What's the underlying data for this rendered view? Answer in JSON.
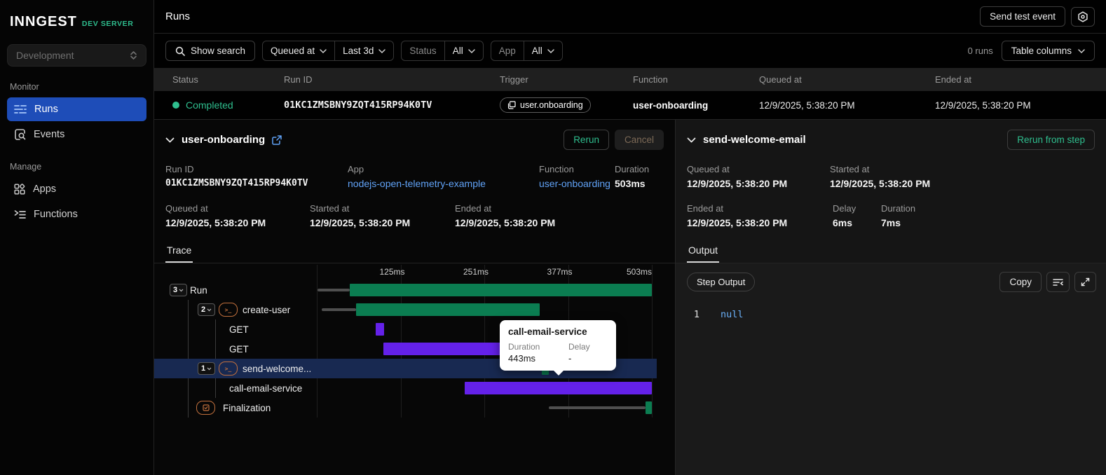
{
  "colors": {
    "green": "#0b7d51",
    "purple": "#6421e9",
    "accent_green": "#2fbf8f",
    "link_blue": "#61a3f8",
    "selected_row": "#182951",
    "sidebar_active": "#1e4db8",
    "step_icon_orange": "#c2703d"
  },
  "sidebar": {
    "logo": "INNGEST",
    "badge": "DEV SERVER",
    "env_select": {
      "value": "Development"
    },
    "sections": [
      {
        "label": "Monitor",
        "items": [
          {
            "label": "Runs",
            "icon": "runs-icon",
            "active": true
          },
          {
            "label": "Events",
            "icon": "events-icon",
            "active": false
          }
        ]
      },
      {
        "label": "Manage",
        "items": [
          {
            "label": "Apps",
            "icon": "apps-icon",
            "active": false
          },
          {
            "label": "Functions",
            "icon": "functions-icon",
            "active": false
          }
        ]
      }
    ]
  },
  "header": {
    "title": "Runs",
    "send_test_event": "Send test event"
  },
  "filters": {
    "show_search": "Show search",
    "queued_at": "Queued at",
    "time_range": "Last 3d",
    "status_label": "Status",
    "status_value": "All",
    "app_label": "App",
    "app_value": "All",
    "runs_count": "0 runs",
    "table_columns": "Table columns"
  },
  "table": {
    "columns": [
      "Status",
      "Run ID",
      "Trigger",
      "Function",
      "Queued at",
      "Ended at"
    ],
    "row": {
      "status": "Completed",
      "run_id": "01KC1ZMSBNY9ZQT415RP94K0TV",
      "trigger": "user.onboarding",
      "function": "user-onboarding",
      "queued_at": "12/9/2025, 5:38:20 PM",
      "ended_at": "12/9/2025, 5:38:20 PM"
    }
  },
  "run_panel": {
    "title": "user-onboarding",
    "rerun": "Rerun",
    "cancel": "Cancel",
    "row1": [
      {
        "label": "Run ID",
        "value": "01KC1ZMSBNY9ZQT415RP94K0TV"
      },
      {
        "label": "App",
        "value": "nodejs-open-telemetry-example"
      },
      {
        "label": "Function",
        "value": "user-onboarding"
      },
      {
        "label": "Duration",
        "value": "503ms"
      }
    ],
    "row2": [
      {
        "label": "Queued at",
        "value": "12/9/2025, 5:38:20 PM"
      },
      {
        "label": "Started at",
        "value": "12/9/2025, 5:38:20 PM"
      },
      {
        "label": "Ended at",
        "value": "12/9/2025, 5:38:20 PM"
      }
    ],
    "tab": "Trace"
  },
  "trace": {
    "axis_max_ms": 503,
    "axis_labels": [
      {
        "text": "125ms",
        "pct": 25
      },
      {
        "text": "251ms",
        "pct": 50
      },
      {
        "text": "377ms",
        "pct": 75
      },
      {
        "text": "503ms",
        "pct": 100
      }
    ],
    "rows": [
      {
        "label": "Run",
        "badge": "3",
        "selected": false,
        "spans": [
          {
            "kind": "queue",
            "start": 1,
            "end": 49
          },
          {
            "kind": "bar",
            "start": 49,
            "end": 503,
            "color": "green"
          }
        ]
      },
      {
        "label": "create-user",
        "badge": "2",
        "icon": "terminal-step-icon",
        "selected": false,
        "spans": [
          {
            "kind": "queue",
            "start": 7,
            "end": 59
          },
          {
            "kind": "bar",
            "start": 59,
            "end": 335,
            "color": "green"
          }
        ]
      },
      {
        "label": "GET",
        "selected": false,
        "spans": [
          {
            "kind": "bar",
            "start": 88,
            "end": 101,
            "color": "purple"
          }
        ]
      },
      {
        "label": "GET",
        "selected": false,
        "spans": [
          {
            "kind": "bar",
            "start": 100,
            "end": 303,
            "color": "purple"
          }
        ]
      },
      {
        "label": "send-welcome...",
        "badge": "1",
        "icon": "terminal-step-icon",
        "selected": true,
        "spans": [
          {
            "kind": "bar",
            "start": 338,
            "end": 348,
            "color": "green"
          }
        ]
      },
      {
        "label": "call-email-service",
        "selected": false,
        "spans": [
          {
            "kind": "bar",
            "start": 222,
            "end": 503,
            "color": "purple"
          }
        ]
      },
      {
        "label": "Finalization",
        "icon": "finalization-check-icon",
        "selected": false,
        "spans": [
          {
            "kind": "queue",
            "start": 348,
            "end": 494
          },
          {
            "kind": "bar",
            "start": 494,
            "end": 503,
            "color": "green"
          }
        ]
      }
    ],
    "tooltip": {
      "title": "call-email-service",
      "duration_label": "Duration",
      "duration_value": "443ms",
      "delay_label": "Delay",
      "delay_value": "-"
    }
  },
  "step_panel": {
    "title": "send-welcome-email",
    "rerun_from_step": "Rerun from step",
    "row1": [
      {
        "label": "Queued at",
        "value": "12/9/2025, 5:38:20 PM"
      },
      {
        "label": "Started at",
        "value": "12/9/2025, 5:38:20 PM"
      }
    ],
    "row2": [
      {
        "label": "Ended at",
        "value": "12/9/2025, 5:38:20 PM"
      },
      {
        "label": "Delay",
        "value": "6ms"
      },
      {
        "label": "Duration",
        "value": "7ms"
      }
    ],
    "tab": "Output",
    "output": {
      "badge": "Step Output",
      "copy": "Copy",
      "line_number": "1",
      "value": "null"
    }
  }
}
